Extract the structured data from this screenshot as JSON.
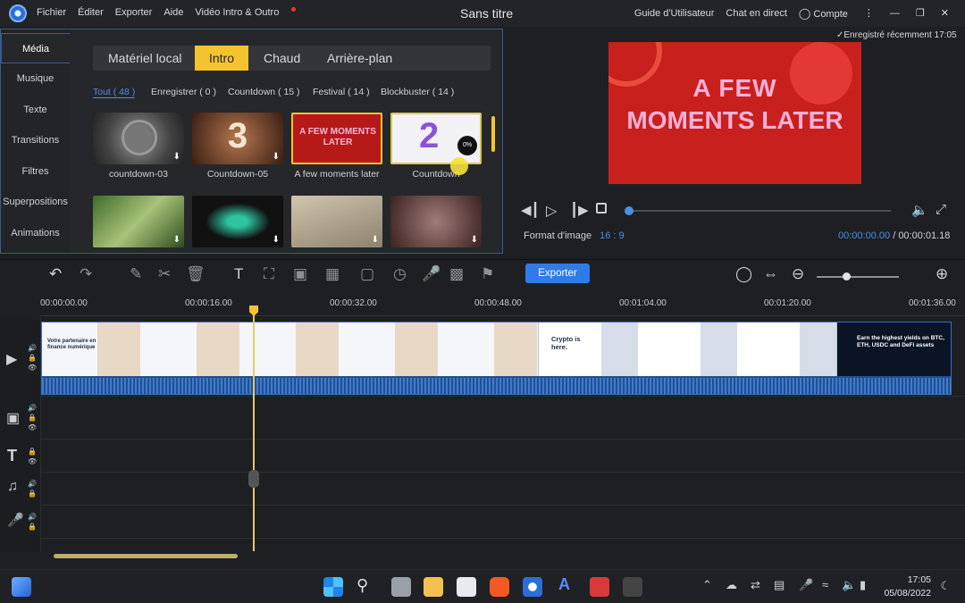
{
  "titlebar": {
    "menu": [
      "Fichier",
      "Éditer",
      "Exporter",
      "Aide",
      "Vidéo Intro & Outro"
    ],
    "title": "Sans titre",
    "guide": "Guide d'Utilisateur",
    "chat": "Chat en direct",
    "account": "Compte"
  },
  "media": {
    "nav": [
      "Média",
      "Musique",
      "Texte",
      "Transitions",
      "Filtres",
      "Superpositions",
      "Animations"
    ],
    "categories": [
      "Matériel local",
      "Intro",
      "Chaud",
      "Arrière-plan"
    ],
    "filters": [
      "Tout ( 48 )",
      "Enregistrer ( 0 )",
      "Countdown ( 15 )",
      "Festival ( 14 )",
      "Blockbuster ( 14 )"
    ],
    "thumbs": [
      {
        "label": "countdown-03"
      },
      {
        "label": "Countdown-05",
        "glyph": "3"
      },
      {
        "label": "A few moments later",
        "text": "A FEW MOMENTS LATER"
      },
      {
        "label": "Countdown",
        "glyph": "2",
        "progress": "0%"
      }
    ]
  },
  "preview": {
    "saved": "Enregistré récemment 17:05",
    "text_line1": "A FEW",
    "text_line2": "MOMENTS LATER",
    "aspect_label": "Format d'image",
    "aspect_value": "16 : 9",
    "time_current": "00:00:00.00",
    "time_sep": "/",
    "time_total": "00:00:01.18",
    "progress": 0.0
  },
  "toolbar": {
    "export": "Exporter"
  },
  "ruler": {
    "ticks": [
      "00:00:00.00",
      "00:00:16.00",
      "00:00:32.00",
      "00:00:48.00",
      "00:01:04.00",
      "00:01:20.00",
      "00:01:36.00"
    ]
  },
  "clips": {
    "a_title": "Votre partenaire en finance numérique",
    "b_title": "Crypto is here.",
    "c_title": "Earn the highest yields on BTC, ETH, USDC and DeFi assets"
  },
  "taskbar": {
    "time": "17:05",
    "date": "05/08/2022"
  }
}
